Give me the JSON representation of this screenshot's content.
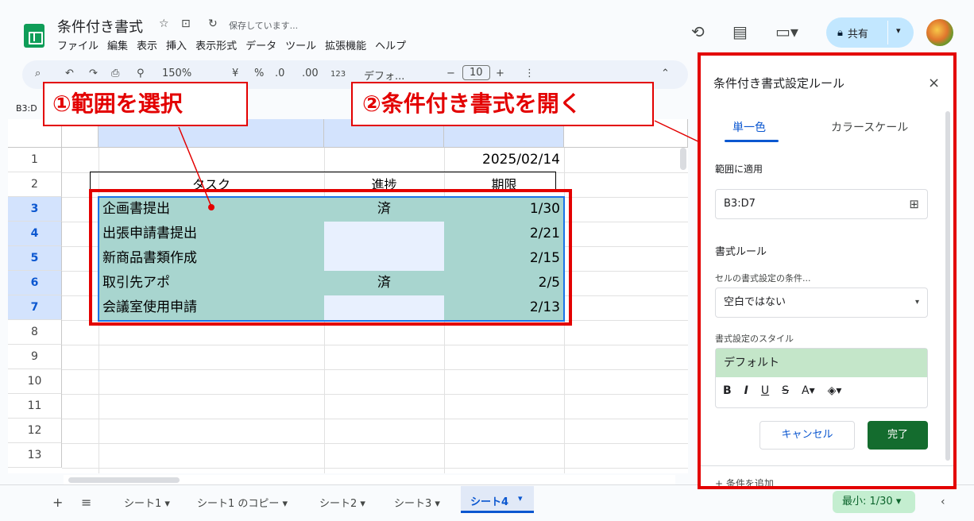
{
  "header": {
    "title": "条件付き書式",
    "saving": "保存しています...",
    "menu": [
      "ファイル",
      "編集",
      "表示",
      "挿入",
      "表示形式",
      "データ",
      "ツール",
      "拡張機能",
      "ヘルプ"
    ],
    "share_label": "共有"
  },
  "toolbar": {
    "zoom": "150%",
    "currency": "¥",
    "percent": "%",
    "dec_down": ".0",
    "dec_up": ".00",
    "num_fmt": "123",
    "font": "デフォ...",
    "font_size": "10"
  },
  "namebox": "B3:D",
  "rows": [
    "1",
    "2",
    "3",
    "4",
    "5",
    "6",
    "7",
    "8",
    "9",
    "10",
    "11",
    "12",
    "13"
  ],
  "table": {
    "date": "2025/02/14",
    "headers": [
      "タスク",
      "進捗",
      "期限"
    ],
    "rows": [
      {
        "task": "企画書提出",
        "status": "済",
        "due": "1/30"
      },
      {
        "task": "出張申請書提出",
        "status": "",
        "due": "2/21"
      },
      {
        "task": "新商品書類作成",
        "status": "",
        "due": "2/15"
      },
      {
        "task": "取引先アポ",
        "status": "済",
        "due": "2/5"
      },
      {
        "task": "会議室使用申請",
        "status": "",
        "due": "2/13"
      }
    ]
  },
  "callouts": {
    "step1": "①範囲を選択",
    "step2": "②条件付き書式を開く"
  },
  "sheets": [
    "シート1",
    "シート1 のコピー",
    "シート2",
    "シート3",
    "シート4"
  ],
  "active_sheet": "シート4",
  "summary": "最小: 1/30",
  "panel": {
    "title": "条件付き書式設定ルール",
    "tab_mono": "単一色",
    "tab_scale": "カラースケール",
    "range_label": "範囲に適用",
    "range_value": "B3:D7",
    "rules_label": "書式ルール",
    "condition_label": "セルの書式設定の条件...",
    "condition_value": "空白ではない",
    "style_label": "書式設定のスタイル",
    "style_preview": "デフォルト",
    "cancel": "キャンセル",
    "done": "完了",
    "add_condition": "+ 条件を追加"
  },
  "colors": {
    "teal": "#a8d5cf",
    "selection": "#e8f0fe",
    "annotation": "#e30000",
    "done_button": "#146c2e"
  }
}
